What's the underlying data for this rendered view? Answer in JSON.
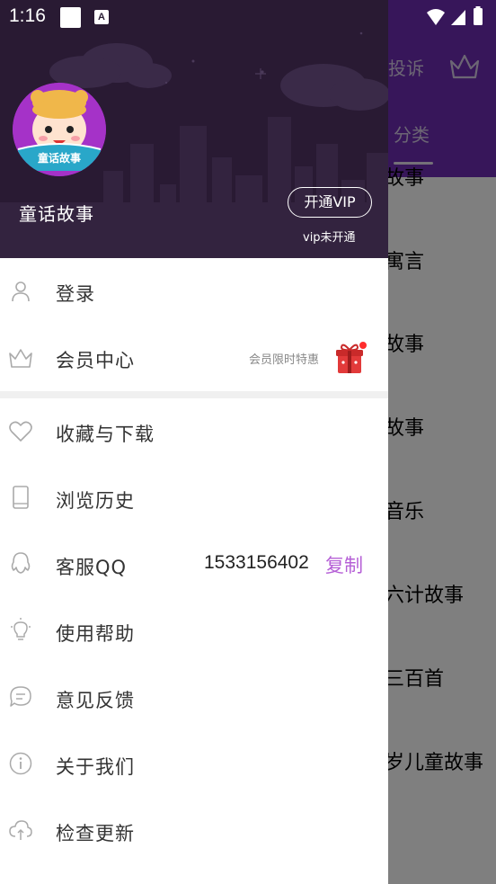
{
  "status_bar": {
    "time": "1:16",
    "notification_label": "A"
  },
  "background_app": {
    "complaint_label": "投诉",
    "tab_label": "分类",
    "list_items": [
      "故事",
      "寓言",
      "故事",
      "故事",
      "音乐",
      "六计故事",
      "三百首",
      "岁儿童故事"
    ]
  },
  "drawer": {
    "app_name": "童话故事",
    "avatar_text": "童话故事",
    "vip_button_label": "开通VIP",
    "vip_status": "vip未开通",
    "menu": {
      "login": "登录",
      "member_center": "会员中心",
      "member_promo": "会员限时特惠",
      "favorites": "收藏与下载",
      "history": "浏览历史",
      "qq_service": "客服QQ",
      "qq_number": "1533156402",
      "copy": "复制",
      "help": "使用帮助",
      "feedback": "意见反馈",
      "about": "关于我们",
      "check_update": "检查更新"
    }
  },
  "colors": {
    "header_bg": "#291a33",
    "accent_purple": "#b55fd6",
    "app_purple": "#6e2cb4"
  }
}
